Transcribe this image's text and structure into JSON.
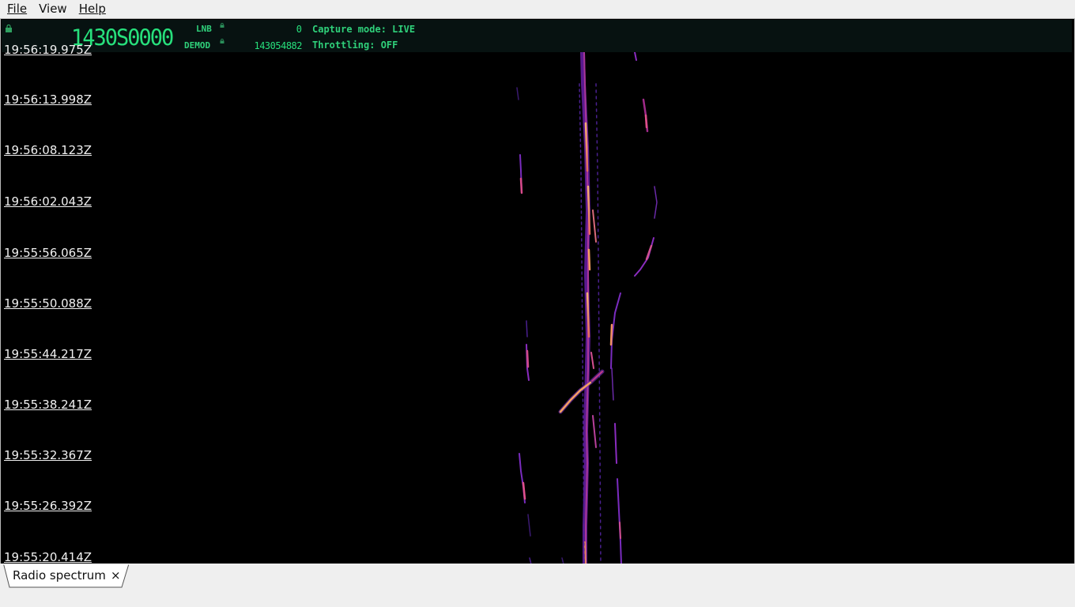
{
  "menu": {
    "items": [
      {
        "label": "File"
      },
      {
        "label": "View"
      },
      {
        "label": "Help"
      }
    ]
  },
  "status": {
    "frequency": "1430S0000",
    "lnb_label": "LNB",
    "lnb_value": "0",
    "demod_label": "DEMOD",
    "demod_value": "143054882",
    "capture_mode": "Capture mode: LIVE",
    "throttling": "Throttling: OFF"
  },
  "waterfall": {
    "timestamps": [
      "19:56:19.975Z",
      "19:56:13.998Z",
      "19:56:08.123Z",
      "19:56:02.043Z",
      "19:55:56.065Z",
      "19:55:50.088Z",
      "19:55:44.217Z",
      "19:55:38.241Z",
      "19:55:32.367Z",
      "19:55:26.392Z",
      "19:55:20.414Z"
    ]
  },
  "tabs": [
    {
      "label": "Radio spectrum",
      "close": "×"
    }
  ],
  "colors": {
    "accent_green": "#27e07c",
    "signal_purple": "#7a2cc0",
    "signal_magenta": "#c0308a",
    "signal_orange": "#f5a060"
  }
}
